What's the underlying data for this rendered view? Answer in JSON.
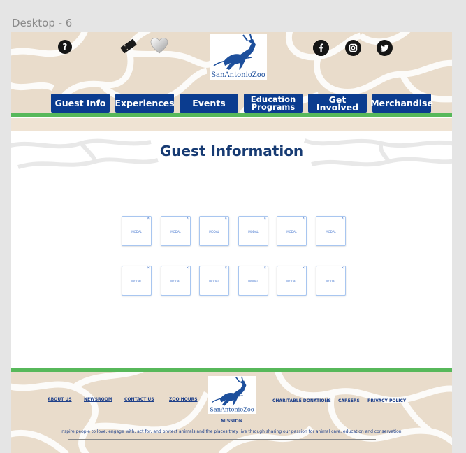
{
  "frame_label": "Desktop - 6",
  "header": {
    "help_icon": "?",
    "logo_text": "SanAntonioZoo",
    "social": [
      "facebook-icon",
      "instagram-icon",
      "twitter-icon"
    ]
  },
  "nav": {
    "items": [
      {
        "label": "Guest Info"
      },
      {
        "label": "Experiences"
      },
      {
        "label": "Events"
      },
      {
        "label": "Education Programs"
      },
      {
        "label": "Get Involved"
      },
      {
        "label": "Merchandise"
      }
    ]
  },
  "page_title": "Guest Information",
  "modals": {
    "label": "MODAL",
    "close": "×",
    "count": 12
  },
  "footer": {
    "links_left": [
      "ABOUT US",
      "NEWSROOM",
      "CONTACT US",
      "ZOO HOURS"
    ],
    "links_right": [
      "CHARITABLE DONATIONS",
      "CAREERS",
      "PRIVACY POLICY"
    ],
    "mission_title": "MISSION",
    "mission_text": "Inspire people to love, engage with, act for, and protect animals and the places they live through sharing our passion for animal care, education and conservation.",
    "logo_text": "SanAntonioZoo"
  },
  "colors": {
    "nav_bg": "#0b3c8f",
    "green_bar": "#57b85a",
    "title_color": "#173b73",
    "giraffe_bg": "#e9dccb",
    "giraffe_lines": "#ffffff"
  }
}
